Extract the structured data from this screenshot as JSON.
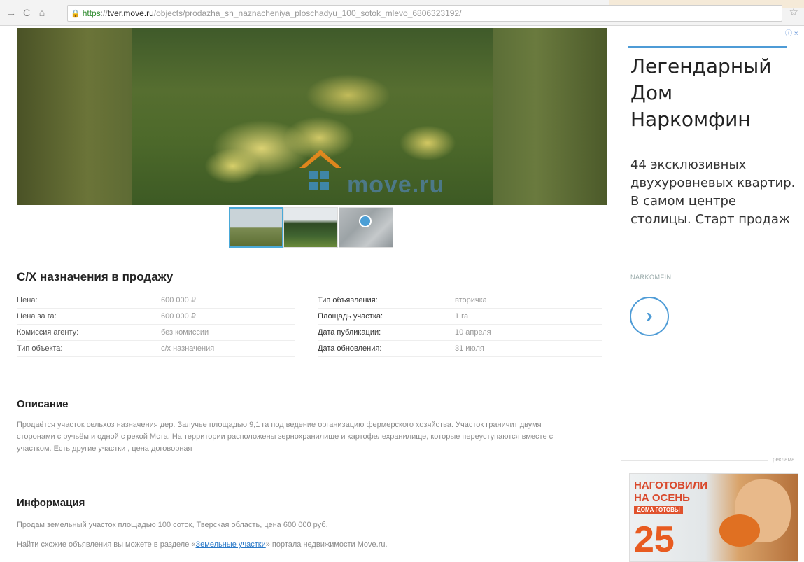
{
  "browser": {
    "url_scheme": "https",
    "url_host": "tver.move.ru",
    "url_path": "/objects/prodazha_sh_naznacheniya_ploschadyu_100_sotok_mlevo_6806323192/",
    "scheme_sep": "://"
  },
  "gallery": {
    "watermark": "move.ru",
    "thumbnails": [
      "photo-1",
      "photo-2",
      "map"
    ]
  },
  "listing": {
    "title": "С/Х назначения в продажу",
    "props_left": [
      {
        "key": "Цена:",
        "value": "600 000 ₽"
      },
      {
        "key": "Цена за га:",
        "value": "600 000 ₽"
      },
      {
        "key": "Комиссия агенту:",
        "value": "без комиссии"
      },
      {
        "key": "Тип объекта:",
        "value": "с/х назначения"
      }
    ],
    "props_right": [
      {
        "key": "Тип объявления:",
        "value": "вторичка"
      },
      {
        "key": "Площадь участка:",
        "value": "1 га"
      },
      {
        "key": "Дата публикации:",
        "value": "10 апреля"
      },
      {
        "key": "Дата обновления:",
        "value": "31 июля"
      }
    ],
    "description_heading": "Описание",
    "description": "Продаётся участок сельхоз назначения дер. Залучье площадью 9,1 га под ведение организацию фермерского хозяйства. Участок граничит двумя сторонами с ручьём и одной с рекой Мста. На территории расположены зернохранилище и картофелехранилище, которые переуступаются вместе с участком. Есть другие участки , цена договорная",
    "info_heading": "Информация",
    "info_line1": "Продам земельный участок площадью 100 соток, Тверская область, цена 600 000 руб.",
    "info_line2_pre": "Найти схожие объявления вы можете в разделе «",
    "info_line2_link": "Земельные участки",
    "info_line2_post": "» портала недвижимости Move.ru."
  },
  "ad": {
    "corner": "ⓘ ×",
    "headline": "Легендарный Дом Наркомфин",
    "body": "44 эксклюзивных двухуровневых квартир. В самом центре столицы. Старт продаж",
    "brand": "NARKOMFIN",
    "arrow": "›"
  },
  "ad2": {
    "label": "реклама",
    "banner_line1": "НАГОТОВИЛИ",
    "banner_line2": "НА ОСЕНЬ",
    "banner_tag": "ДОМА ГОТОВЫ",
    "banner_number": "25"
  },
  "colors": {
    "accent": "#4d9bd6",
    "link": "#2a79c8",
    "banner_red": "#d9482b"
  }
}
